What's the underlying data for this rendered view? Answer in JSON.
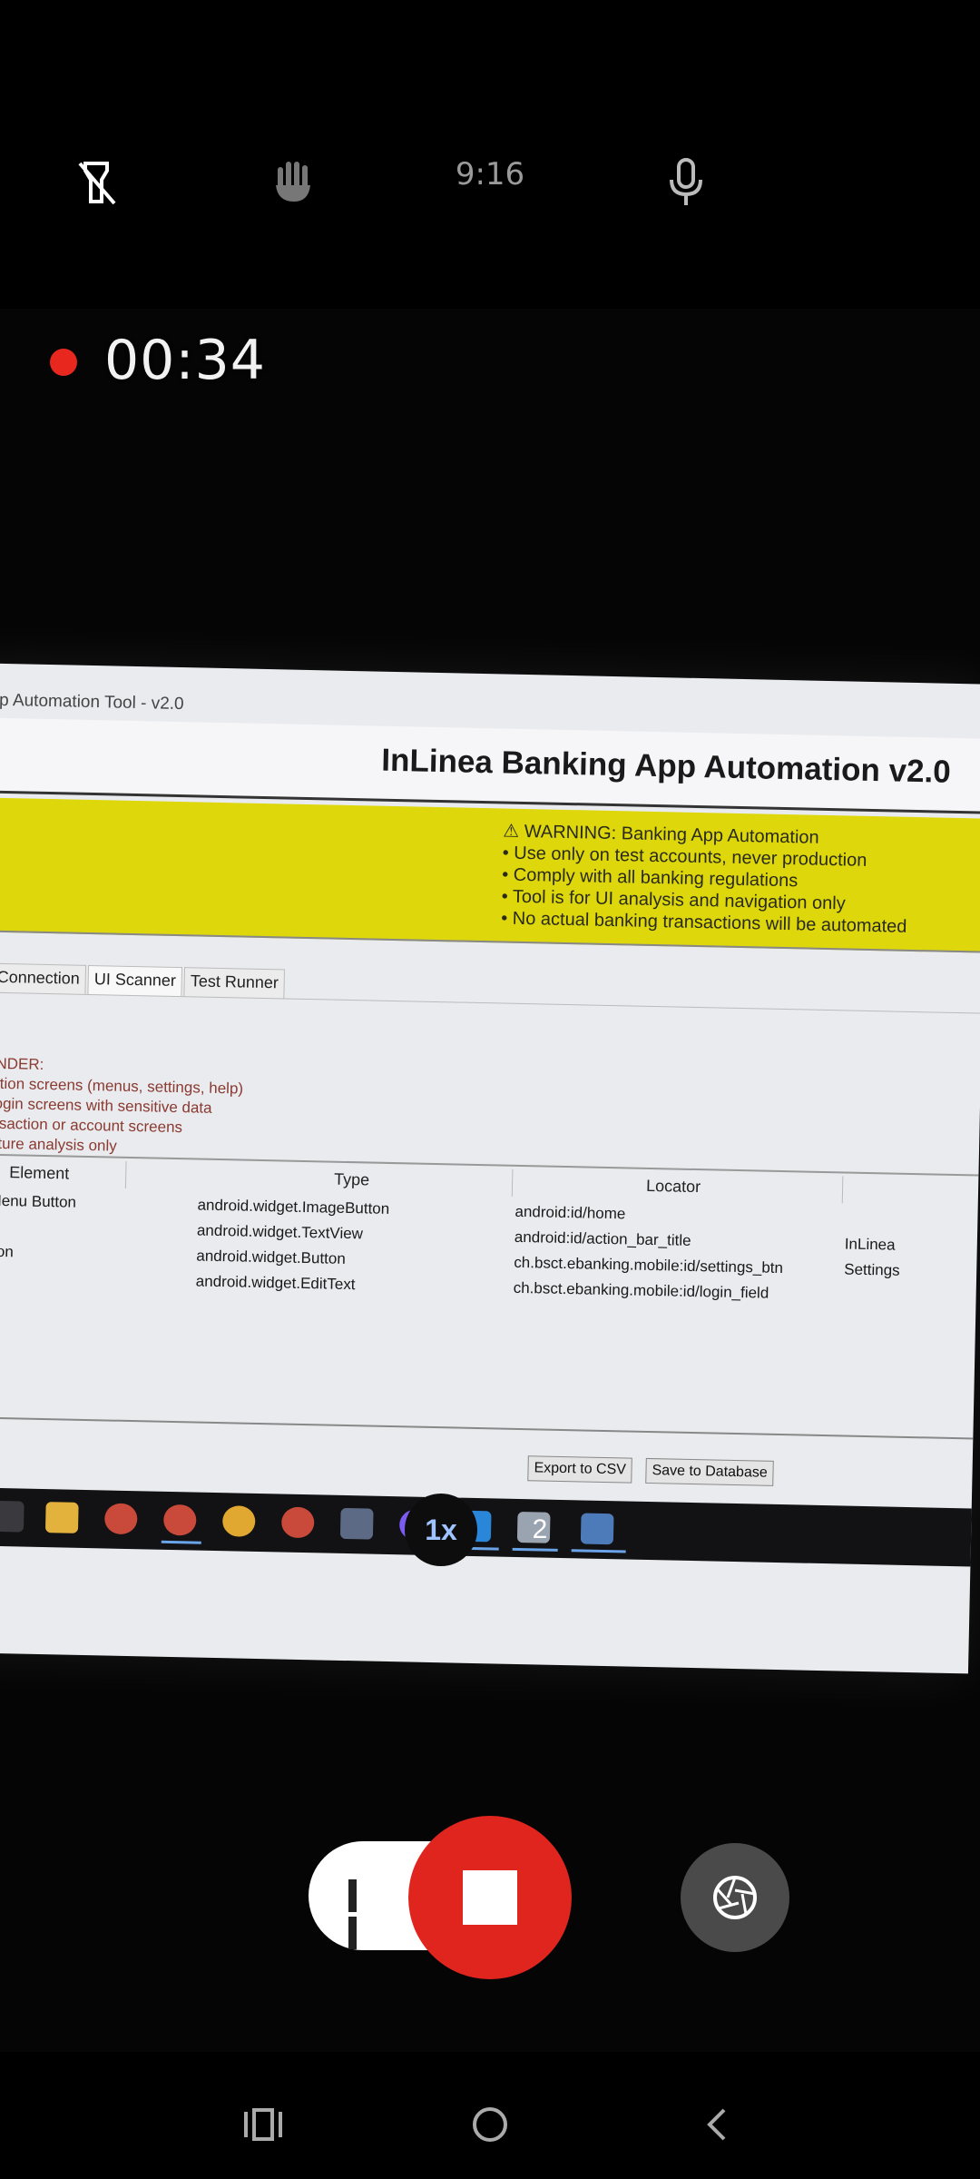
{
  "status_bar": {
    "time": "9:16",
    "icons": [
      "flashlight-off-icon",
      "hand-gesture-icon",
      "microphone-icon"
    ]
  },
  "recording": {
    "elapsed": "00:34"
  },
  "captured_screen": {
    "window_title": "p Automation Tool - v2.0",
    "app_title": "InLinea Banking App Automation v2.0",
    "warning": {
      "heading": "⚠ WARNING: Banking App Automation",
      "lines": [
        "• Use only on test accounts, never production",
        "• Comply with all banking regulations",
        "• Tool is for UI analysis and navigation only",
        "• No actual banking transactions will be automated"
      ]
    },
    "tabs": [
      "vice Connection",
      "UI Scanner",
      "Test Runner"
    ],
    "reminder": [
      "INDER:",
      "ation screens (menus, settings, help)",
      "login screens with sensitive data",
      "nsaction or account screens",
      "cture analysis only"
    ],
    "table": {
      "headers": [
        "Element",
        "Type",
        "Locator"
      ],
      "rows": [
        {
          "element": "Menu Button",
          "type": "android.widget.ImageButton",
          "locator": "android:id/home",
          "extra": ""
        },
        {
          "element": "",
          "type": "android.widget.TextView",
          "locator": "android:id/action_bar_title",
          "extra": "InLinea"
        },
        {
          "element": "tton",
          "type": "android.widget.Button",
          "locator": "ch.bsct.ebanking.mobile:id/settings_btn",
          "extra": "Settings"
        },
        {
          "element": "",
          "type": "android.widget.EditText",
          "locator": "ch.bsct.ebanking.mobile:id/login_field",
          "extra": ""
        }
      ]
    },
    "buttons": {
      "export": "Export to CSV",
      "save": "Save to Database"
    }
  },
  "zoom": {
    "primary": "1x",
    "secondary": "2"
  },
  "colors": {
    "record_red": "#e0251e",
    "warning_yellow": "#ddd70c",
    "zoom_active": "#9ec3ff"
  }
}
